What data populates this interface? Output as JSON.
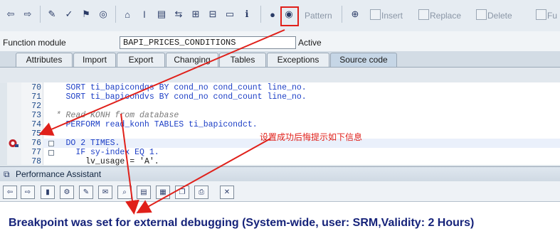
{
  "toolbar": {
    "pattern_label": "Pattern",
    "insert_label": "Insert",
    "replace_label": "Replace",
    "delete_label": "Delete",
    "fu_label": "Fu"
  },
  "function_module": {
    "label": "Function module",
    "value": "BAPI_PRICES_CONDITIONS",
    "status": "Active"
  },
  "tabs": [
    {
      "label": "Attributes"
    },
    {
      "label": "Import"
    },
    {
      "label": "Export"
    },
    {
      "label": "Changing"
    },
    {
      "label": "Tables"
    },
    {
      "label": "Exceptions"
    },
    {
      "label": "Source code"
    }
  ],
  "editor": {
    "lines": [
      {
        "no": "70",
        "code": "SORT ti_bapicondqs BY cond_no cond_count line_no."
      },
      {
        "no": "71",
        "code": "SORT ti_bapicondvs BY cond_no cond_count line_no."
      },
      {
        "no": "72",
        "code": ""
      },
      {
        "no": "73",
        "code": "* Read KONH from database"
      },
      {
        "no": "74",
        "code": "PERFORM read_konh TABLES ti_bapicondct."
      },
      {
        "no": "75",
        "code": ""
      },
      {
        "no": "76",
        "code": "DO 2 TIMES."
      },
      {
        "no": "77",
        "code": "IF sy-index EQ 1."
      },
      {
        "no": "78",
        "code": "lv_usage = 'A'."
      }
    ],
    "annotation": "设置成功后悔提示如下信息"
  },
  "performance_assistant": {
    "title": "Performance Assistant",
    "message": "Breakpoint was set for external debugging  (System-wide, user: SRM,Validity: 2 Hours)"
  },
  "colors": {
    "annotation_red": "#e0201a",
    "message_blue": "#16237a",
    "keyword_blue": "#1d3fc6"
  }
}
